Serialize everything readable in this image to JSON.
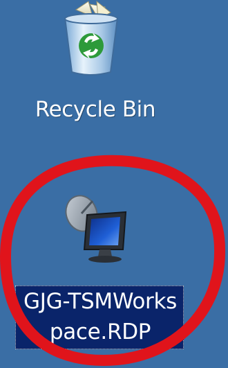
{
  "desktop": {
    "background_color": "#3a6ea5",
    "icons": [
      {
        "label": "Recycle Bin",
        "icon": "recycle-bin-icon"
      },
      {
        "label_line1": "GJG-TSMWorks",
        "label_line2": "pace.RDP",
        "icon": "remote-desktop-icon",
        "selected": true
      }
    ]
  },
  "annotation": {
    "shape": "ellipse",
    "color": "#e0141b"
  }
}
